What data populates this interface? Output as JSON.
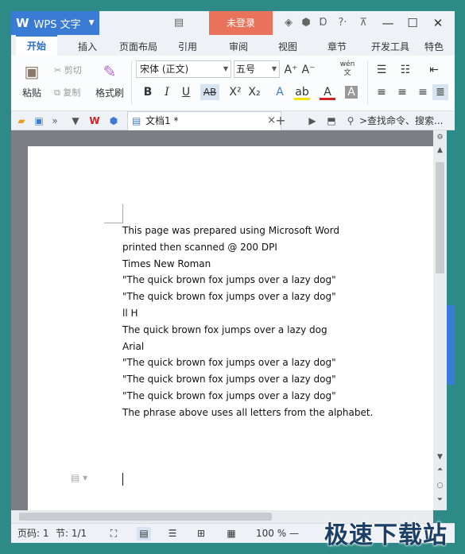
{
  "window": {
    "app_logo": "W",
    "app_name": "WPS 文字",
    "login_label": "未登录"
  },
  "tabs": [
    "开始",
    "插入",
    "页面布局",
    "引用",
    "审阅",
    "视图",
    "章节",
    "开发工具",
    "特色"
  ],
  "ribbon": {
    "paste_label": "粘贴",
    "cut_label": "剪切",
    "copy_label": "复制",
    "format_painter_label": "格式刷",
    "font_name": "宋体 (正文)",
    "font_size": "五号",
    "wen_label": "wén 文"
  },
  "document_tab": {
    "title": "文档1 *",
    "close_glyph": "×",
    "new_tab_glyph": "+"
  },
  "search": {
    "placeholder": ">查找命令、搜索..."
  },
  "document": {
    "lines": [
      "This page was prepared using Microsoft Word",
      "printed then scanned @ 200 DPI",
      "Times New Roman",
      "\"The quick brown fox jumps over a lazy dog\"",
      "\"The quick brown fox jumps over a lazy dog\"",
      "ll H",
      "The quick brown fox jumps over a lazy dog",
      "Arial",
      "\"The quick brown fox jumps over a lazy dog\"",
      "\"The quick brown fox jumps over a lazy dog\"",
      "\"The quick brown fox jumps over a lazy dog\"",
      "The phrase above uses all letters from the alphabet."
    ]
  },
  "status": {
    "page": "页码: 1",
    "section": "节: 1/1",
    "zoom": "100 %",
    "zoom_minus": "—"
  },
  "watermark": "极速下载站",
  "colors": {
    "accent": "#3a7bd5",
    "login": "#e8735a",
    "frame": "#2e8a86"
  }
}
